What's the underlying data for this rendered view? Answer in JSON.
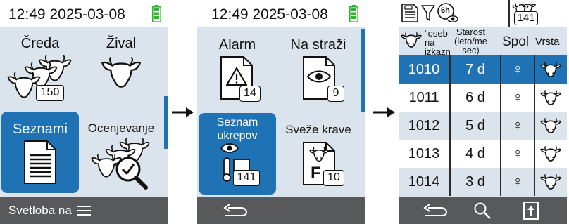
{
  "screen1": {
    "clock": "12:49 2025-03-08",
    "tiles": [
      {
        "label": "Čreda",
        "badge": "150"
      },
      {
        "label": "Žival",
        "badge": ""
      },
      {
        "label": "Seznami",
        "badge": ""
      },
      {
        "label": "Ocenjevanje",
        "badge": ""
      }
    ],
    "bottom_label": "Svetloba na",
    "selected_tile": "Seznami"
  },
  "screen2": {
    "clock": "12:49 2025-03-08",
    "tiles": [
      {
        "label": "Alarm",
        "badge": "14"
      },
      {
        "label": "Na straži",
        "badge": "9"
      },
      {
        "label_line1": "Seznam",
        "label_line2": "ukrepov",
        "badge": "141"
      },
      {
        "label": "Sveže krave",
        "badge": "10"
      }
    ],
    "fresh_cow_letter": "F",
    "selected_tile": "Seznam ukrepov"
  },
  "screen3": {
    "filter_time_label": "6h",
    "herd_count": "141",
    "columns": {
      "id_line1": "\"oseb",
      "id_line2": "na",
      "id_line3": "izkazn",
      "age_line1": "Starost",
      "age_line2": "(leto/me",
      "age_line3": "sec)",
      "sex": "Spol",
      "type": "Vrsta"
    },
    "rows": [
      {
        "id": "1010",
        "age": "7 d",
        "sex": "♀"
      },
      {
        "id": "1011",
        "age": "6 d",
        "sex": "♀"
      },
      {
        "id": "1012",
        "age": "5 d",
        "sex": "♀"
      },
      {
        "id": "1013",
        "age": "4 d",
        "sex": "♀"
      },
      {
        "id": "1014",
        "age": "3 d",
        "sex": "♀"
      }
    ],
    "selected_row": 0
  },
  "colors": {
    "accent": "#1f72b4",
    "screen_bg": "#dbe4ec",
    "bottom_bar": "#58595b",
    "battery": "#2fb52f"
  }
}
